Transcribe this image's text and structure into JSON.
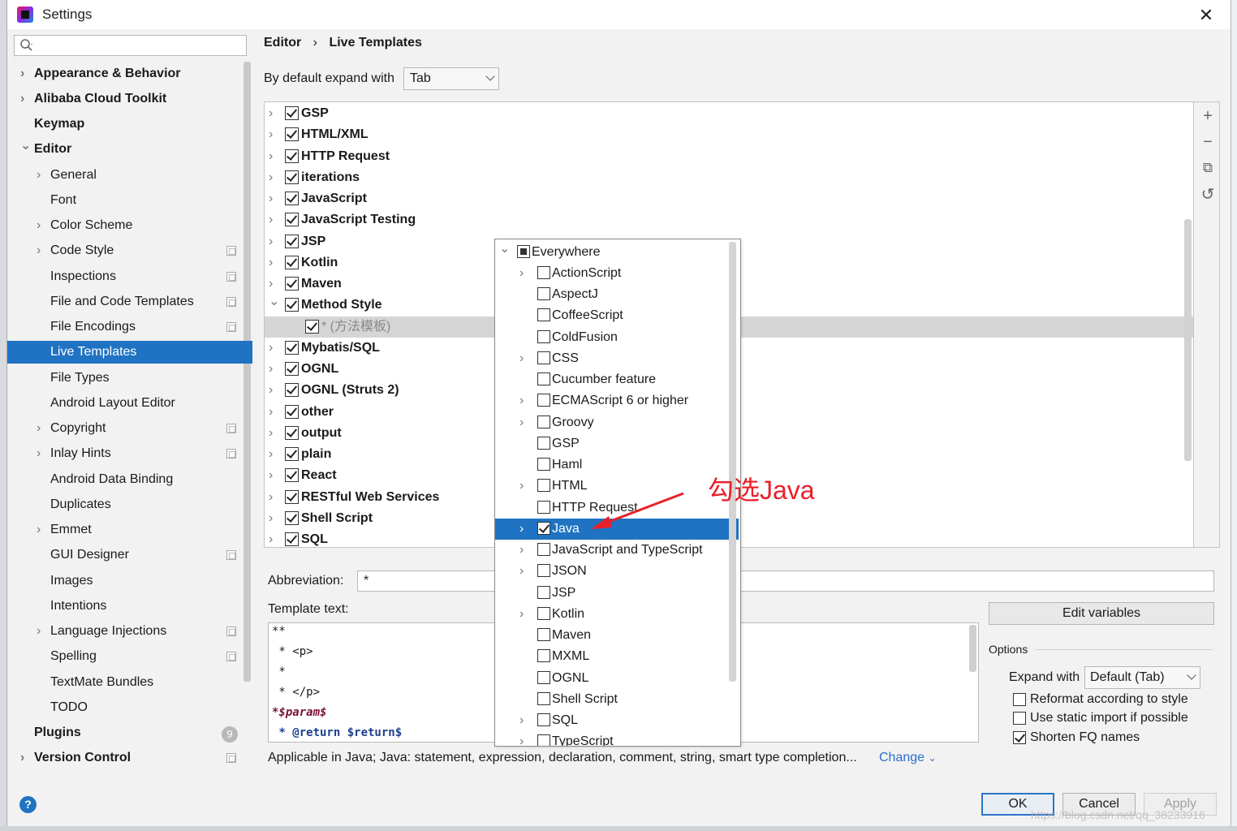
{
  "window": {
    "title": "Settings"
  },
  "search": {
    "placeholder": ""
  },
  "sidebar": {
    "items": [
      {
        "label": "Appearance & Behavior",
        "bold": true,
        "chev": "›"
      },
      {
        "label": "Alibaba Cloud Toolkit",
        "bold": true,
        "chev": "›"
      },
      {
        "label": "Keymap",
        "bold": true
      },
      {
        "label": "Editor",
        "bold": true,
        "chev": "⌄"
      },
      {
        "label": "General",
        "chev": "›"
      },
      {
        "label": "Font"
      },
      {
        "label": "Color Scheme",
        "chev": "›"
      },
      {
        "label": "Code Style",
        "chev": "›",
        "copy": true
      },
      {
        "label": "Inspections",
        "copy": true
      },
      {
        "label": "File and Code Templates",
        "copy": true
      },
      {
        "label": "File Encodings",
        "copy": true
      },
      {
        "label": "Live Templates",
        "selected": true
      },
      {
        "label": "File Types"
      },
      {
        "label": "Android Layout Editor"
      },
      {
        "label": "Copyright",
        "chev": "›",
        "copy": true
      },
      {
        "label": "Inlay Hints",
        "chev": "›",
        "copy": true
      },
      {
        "label": "Android Data Binding"
      },
      {
        "label": "Duplicates"
      },
      {
        "label": "Emmet",
        "chev": "›"
      },
      {
        "label": "GUI Designer",
        "copy": true
      },
      {
        "label": "Images"
      },
      {
        "label": "Intentions"
      },
      {
        "label": "Language Injections",
        "chev": "›",
        "copy": true
      },
      {
        "label": "Spelling",
        "copy": true
      },
      {
        "label": "TextMate Bundles"
      },
      {
        "label": "TODO"
      },
      {
        "label": "Plugins",
        "bold": true,
        "badge": "9"
      },
      {
        "label": "Version Control",
        "bold": true,
        "chev": "›",
        "copy": true
      }
    ]
  },
  "breadcrumb": {
    "root": "Editor",
    "separator": "›",
    "current": "Live Templates"
  },
  "expand": {
    "label": "By default expand with",
    "value": "Tab"
  },
  "templates": {
    "groups": [
      {
        "label": "GSP",
        "checked": true
      },
      {
        "label": "HTML/XML",
        "checked": true
      },
      {
        "label": "HTTP Request",
        "checked": true
      },
      {
        "label": "iterations",
        "checked": true
      },
      {
        "label": "JavaScript",
        "checked": true
      },
      {
        "label": "JavaScript Testing",
        "checked": true
      },
      {
        "label": "JSP",
        "checked": true
      },
      {
        "label": "Kotlin",
        "checked": true
      },
      {
        "label": "Maven",
        "checked": true
      },
      {
        "label": "Method Style",
        "checked": true,
        "expanded": true
      },
      {
        "label": "* (方法模板)",
        "checked": true,
        "child": true
      },
      {
        "label": "Mybatis/SQL",
        "checked": true
      },
      {
        "label": "OGNL",
        "checked": true
      },
      {
        "label": "OGNL (Struts 2)",
        "checked": true
      },
      {
        "label": "other",
        "checked": true
      },
      {
        "label": "output",
        "checked": true
      },
      {
        "label": "plain",
        "checked": true
      },
      {
        "label": "React",
        "checked": true
      },
      {
        "label": "RESTful Web Services",
        "checked": true
      },
      {
        "label": "Shell Script",
        "checked": true
      },
      {
        "label": "SQL",
        "checked": true
      }
    ]
  },
  "toolbar": {
    "add": "+",
    "remove": "−",
    "copy": "⧉",
    "restore": "↺"
  },
  "abbreviation": {
    "label": "Abbreviation:",
    "value": "*"
  },
  "template_text": {
    "label": "Template text:",
    "lines": [
      "**",
      " * <p>",
      " *",
      " * </p>",
      "*$param$",
      " * @return $return$"
    ]
  },
  "edit_variables": {
    "label": "Edit variables"
  },
  "options": {
    "label": "Options",
    "expand_with_label": "Expand with",
    "expand_with_value": "Default (Tab)",
    "reformat": "Reformat according to style",
    "static_import": "Use static import if possible",
    "shorten_fq": "Shorten FQ names"
  },
  "applicable": {
    "text": "Applicable in Java; Java: statement, expression, declaration, comment, string, smart type completion...",
    "change": "Change"
  },
  "buttons": {
    "ok": "OK",
    "cancel": "Cancel",
    "apply": "Apply"
  },
  "context_popup": {
    "items": [
      {
        "label": "Everywhere",
        "partial": true,
        "expanded": true
      },
      {
        "label": "ActionScript",
        "chev": true
      },
      {
        "label": "AspectJ"
      },
      {
        "label": "CoffeeScript"
      },
      {
        "label": "ColdFusion"
      },
      {
        "label": "CSS",
        "chev": true
      },
      {
        "label": "Cucumber feature"
      },
      {
        "label": "ECMAScript 6 or higher",
        "chev": true
      },
      {
        "label": "Groovy",
        "chev": true
      },
      {
        "label": "GSP"
      },
      {
        "label": "Haml"
      },
      {
        "label": "HTML",
        "chev": true
      },
      {
        "label": "HTTP Request"
      },
      {
        "label": "Java",
        "chev": true,
        "checked": true,
        "selected": true
      },
      {
        "label": "JavaScript and TypeScript",
        "chev": true
      },
      {
        "label": "JSON",
        "chev": true
      },
      {
        "label": "JSP"
      },
      {
        "label": "Kotlin",
        "chev": true
      },
      {
        "label": "Maven"
      },
      {
        "label": "MXML"
      },
      {
        "label": "OGNL"
      },
      {
        "label": "Shell Script"
      },
      {
        "label": "SQL",
        "chev": true
      },
      {
        "label": "TypeScript",
        "chev": true
      }
    ]
  },
  "annotation": {
    "text": "勾选Java",
    "color": "#e8202a"
  },
  "watermark": "https://blog.csdn.net/qq_38233916",
  "colors": {
    "accent": "#1f73c2",
    "link": "#2a6fc9"
  }
}
